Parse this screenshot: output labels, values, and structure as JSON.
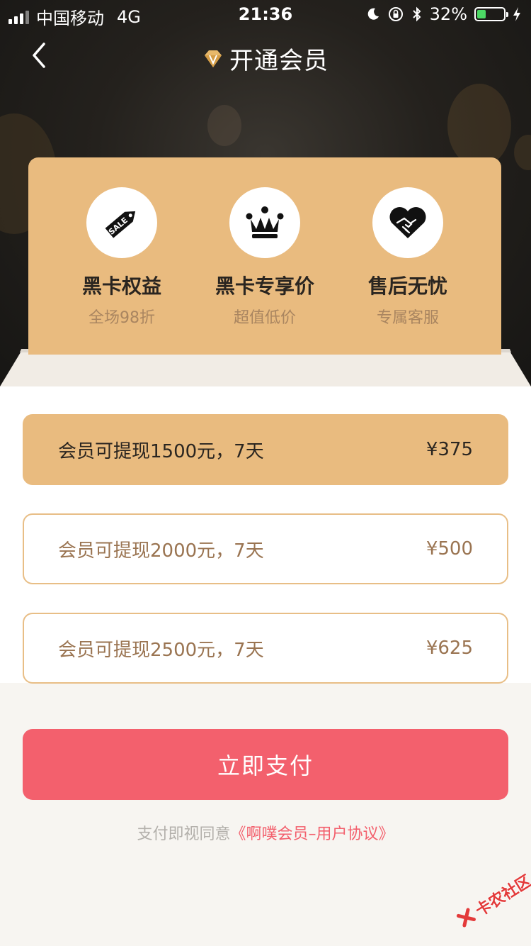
{
  "status_bar": {
    "carrier": "中国移动",
    "network": "4G",
    "time": "21:36",
    "battery": "32%",
    "battery_level": 0.32
  },
  "nav": {
    "title": "开通会员"
  },
  "benefits": [
    {
      "title": "黑卡权益",
      "subtitle": "全场98折",
      "icon": "sale-tag-icon"
    },
    {
      "title": "黑卡专享价",
      "subtitle": "超值低价",
      "icon": "crown-icon"
    },
    {
      "title": "售后无忧",
      "subtitle": "专属客服",
      "icon": "handshake-heart-icon"
    }
  ],
  "plans": [
    {
      "label": "会员可提现1500元，7天",
      "price": "¥375",
      "selected": true
    },
    {
      "label": "会员可提现2000元，7天",
      "price": "¥500",
      "selected": false
    },
    {
      "label": "会员可提现2500元，7天",
      "price": "¥625",
      "selected": false
    }
  ],
  "pay_button": "立即支付",
  "agreement": {
    "prefix": "支付即视同意",
    "link": "《啊噗会员–用户协议》"
  },
  "watermark": "卡农社区",
  "colors": {
    "gold": "#e9bb7f",
    "pay_red": "#f3606d",
    "battery_green": "#4cd964"
  }
}
